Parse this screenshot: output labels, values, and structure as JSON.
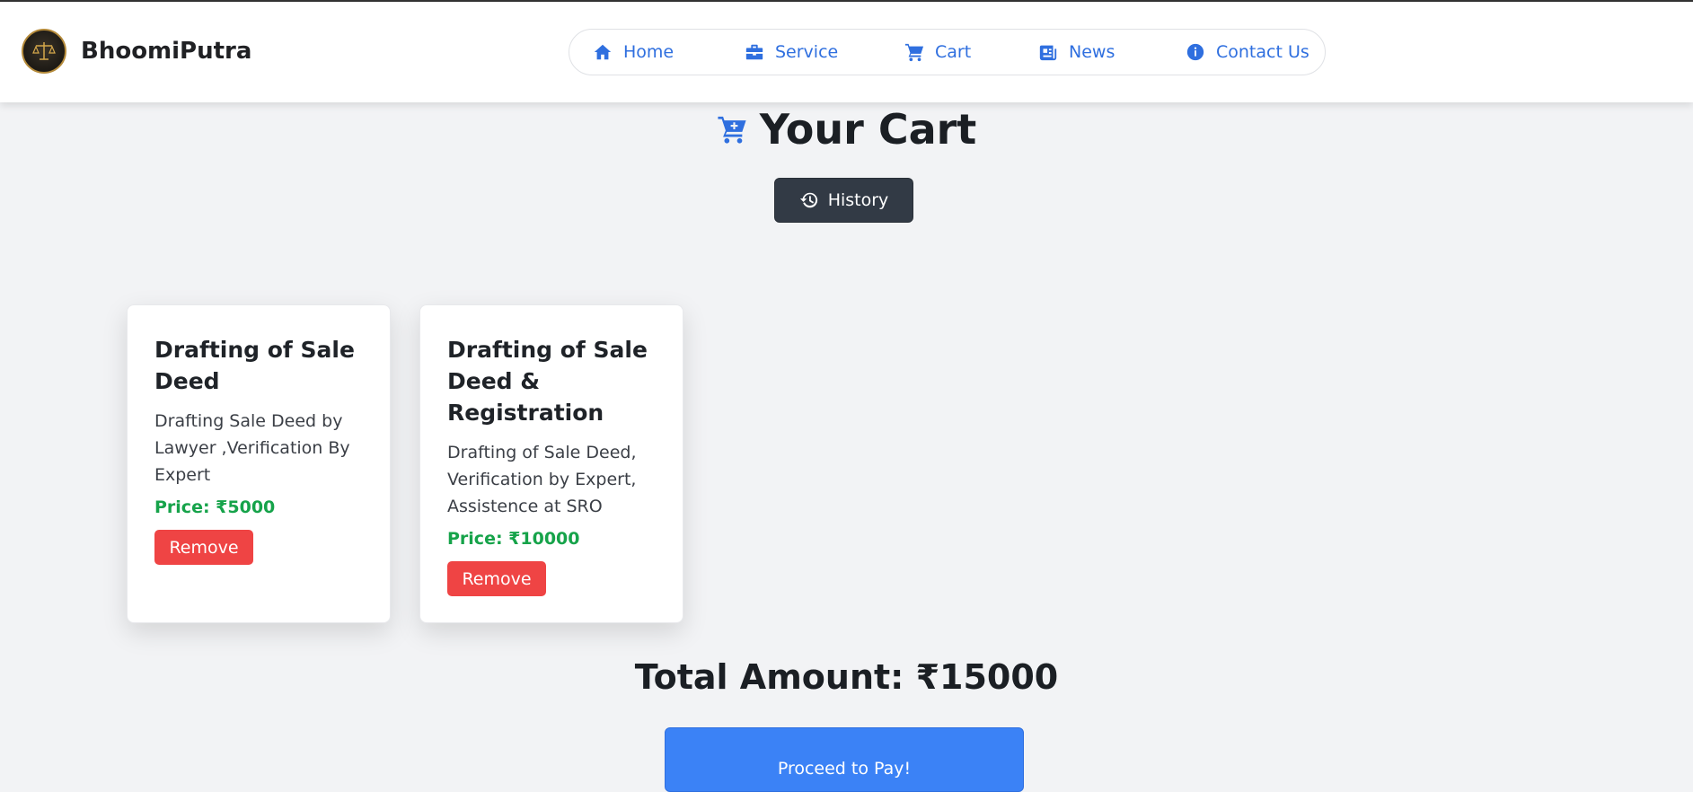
{
  "brand": {
    "name": "BhoomiPutra",
    "logo_icon": "scales-emblem-icon"
  },
  "nav": {
    "items": [
      {
        "label": "Home",
        "icon": "home-icon"
      },
      {
        "label": "Service",
        "icon": "briefcase-icon"
      },
      {
        "label": "Cart",
        "icon": "cart-icon"
      },
      {
        "label": "News",
        "icon": "newspaper-icon"
      },
      {
        "label": "Contact Us",
        "icon": "info-icon"
      }
    ]
  },
  "page": {
    "title": "Your Cart",
    "title_icon": "cart-plus-icon"
  },
  "history_button": {
    "label": "History",
    "icon": "history-icon"
  },
  "cart_items": [
    {
      "title": "Drafting of Sale Deed",
      "description": "Drafting Sale Deed by Lawyer ,Verification By Expert",
      "price": "Price: ₹5000",
      "remove_label": "Remove"
    },
    {
      "title": "Drafting of Sale Deed & Registration",
      "description": "Drafting of Sale Deed, Verification by Expert, Assistence at SRO",
      "price": "Price: ₹10000",
      "remove_label": "Remove"
    }
  ],
  "total": {
    "text": "Total Amount: ₹15000"
  },
  "pay_button": {
    "label": "Proceed to Pay!"
  },
  "colors": {
    "accent": "#2f6fdf",
    "price": "#16a34a",
    "remove": "#ef4444",
    "history_bg": "#323a45",
    "pay_bg": "#3b82f6",
    "page_bg": "#f2f3f5"
  }
}
